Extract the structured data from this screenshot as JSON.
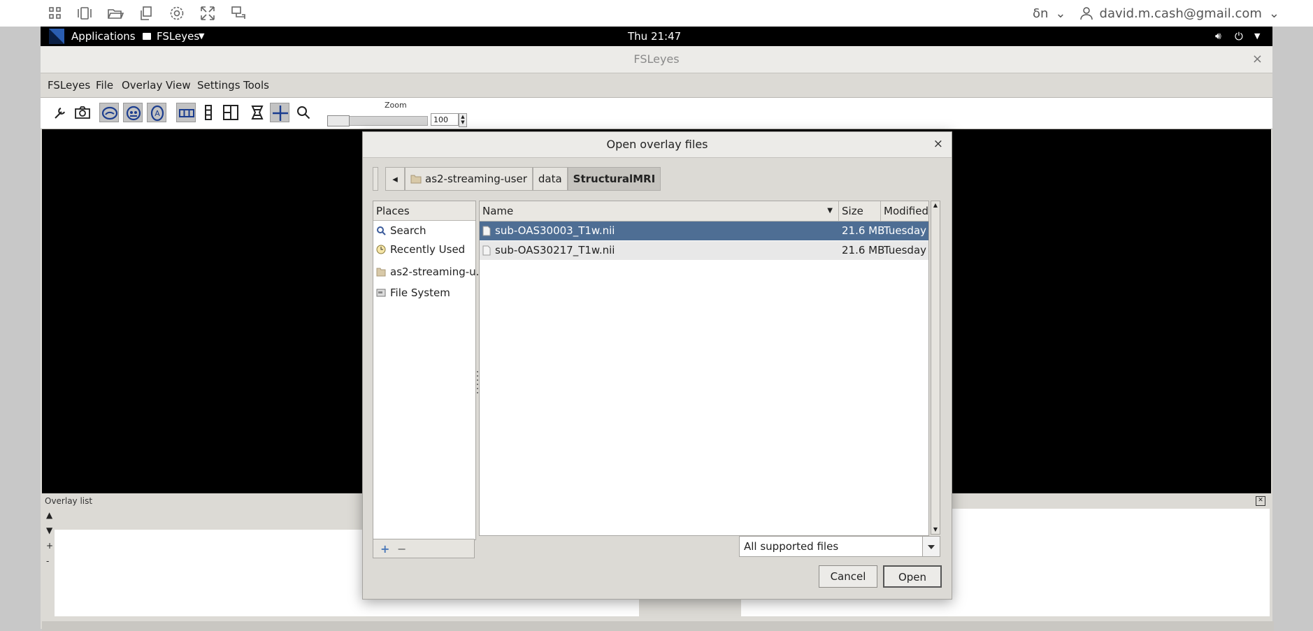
{
  "viewer_bar": {
    "icons": [
      "apps-grid-icon",
      "sidebar-toggle-icon",
      "folder-open-icon",
      "copy-icon",
      "settings-gear-icon",
      "fullscreen-expand-icon",
      "display-icon"
    ],
    "keyboard_label": "ẟn",
    "user_email": "david.m.cash@gmail.com"
  },
  "gnome_panel": {
    "applications": "Applications",
    "app_menu": "FSLeyes",
    "clock": "Thu 21:47"
  },
  "fsleyes": {
    "title": "FSLeyes",
    "close_glyph": "×",
    "menu": [
      "FSLeyes",
      "File",
      "Overlay",
      "View",
      "Settings",
      "Tools"
    ],
    "toolbar": {
      "zoom_label": "Zoom",
      "zoom_value": "100"
    },
    "overlay_panel": {
      "title": "Overlay list",
      "controls": [
        "▲",
        "▼",
        "+",
        "-"
      ]
    }
  },
  "dialog": {
    "title": "Open overlay files",
    "close_glyph": "×",
    "path": [
      "as2-streaming-user",
      "data",
      "StructuralMRI"
    ],
    "places_header": "Places",
    "places": [
      {
        "label": "Search",
        "icon": "search-icon"
      },
      {
        "label": "Recently Used",
        "icon": "clock-icon"
      },
      {
        "label": "as2-streaming-u...",
        "icon": "home-folder-icon"
      },
      {
        "label": "File System",
        "icon": "drive-icon"
      }
    ],
    "places_buttons": [
      "+",
      "−"
    ],
    "columns": {
      "name": "Name",
      "size": "Size",
      "modified": "Modified"
    },
    "files": [
      {
        "name": "sub-OAS30003_T1w.nii",
        "size": "21.6 MB",
        "modified": "Tuesday",
        "selected": true
      },
      {
        "name": "sub-OAS30217_T1w.nii",
        "size": "21.6 MB",
        "modified": "Tuesday",
        "selected": false
      }
    ],
    "filter": "All supported files",
    "cancel": "Cancel",
    "open": "Open"
  },
  "colors": {
    "selection": "#4e6e94",
    "panel_black": "#000000",
    "window_bg": "#dcdad5"
  }
}
